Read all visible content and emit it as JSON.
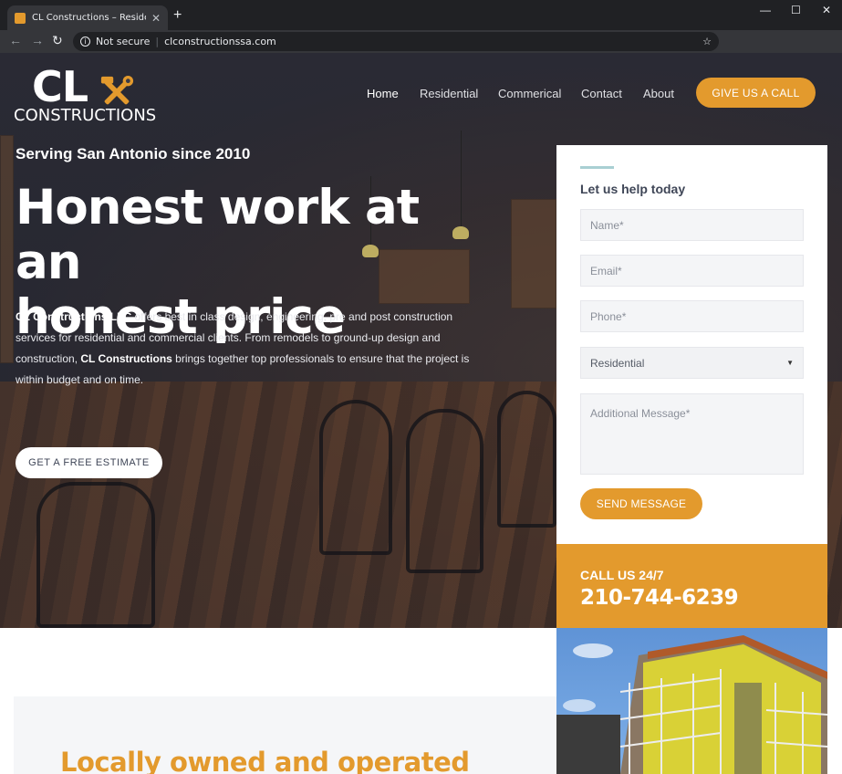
{
  "browser": {
    "tab_title": "CL Constructions – Residential a",
    "tab_close": "✕",
    "new_tab": "+",
    "win_min": "—",
    "win_max": "☐",
    "win_close": "✕",
    "security": "Not secure",
    "url": "clconstructionssa.com"
  },
  "logo": {
    "text_top": "CL",
    "text_bottom": "CONSTRUCTIONS"
  },
  "nav": {
    "items": [
      "Home",
      "Residential",
      "Commerical",
      "Contact",
      "About"
    ],
    "cta": "GIVE US A CALL"
  },
  "hero": {
    "tagline": "Serving San Antonio since 2010",
    "headline_1": "Honest work at an",
    "headline_2": "honest price",
    "intro_b1": "CL Constructions LLC",
    "intro_t1": " offers best in class design, engineering, pre and post construction services for residential and commercial clients. From remodels to ground-up design and construction, ",
    "intro_b2": "CL Constructions",
    "intro_t2": " brings together top professionals to ensure that the project is within budget and on time.",
    "estimate_button": "GET A FREE ESTIMATE"
  },
  "form": {
    "title": "Let us help today",
    "name_placeholder": "Name*",
    "email_placeholder": "Email*",
    "phone_placeholder": "Phone*",
    "service_selected": "Residential",
    "message_placeholder": "Additional Message*",
    "send_button": "SEND MESSAGE"
  },
  "callbox": {
    "label": "CALL US 24/7",
    "phone": "210-744-6239"
  },
  "section": {
    "heading": "Locally owned and operated"
  },
  "colors": {
    "accent": "#e39a2d",
    "text_dark": "#3f4657",
    "chrome_bg": "#202124"
  }
}
